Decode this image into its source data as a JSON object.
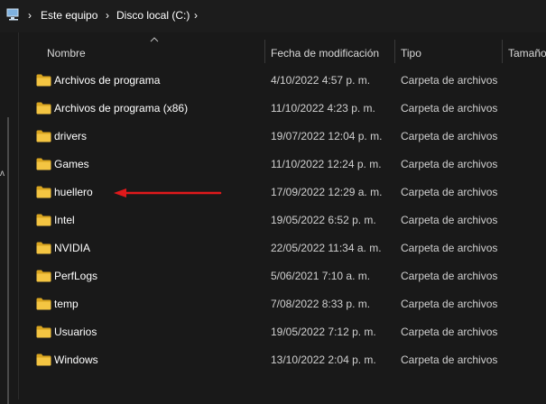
{
  "breadcrumb": {
    "items": [
      "Este equipo",
      "Disco local (C:)"
    ],
    "separator": "›"
  },
  "columns": {
    "name": "Nombre",
    "date": "Fecha de modificación",
    "type": "Tipo",
    "size": "Tamaño"
  },
  "rows": [
    {
      "name": "Archivos de programa",
      "date": "4/10/2022 4:57 p. m.",
      "type": "Carpeta de archivos"
    },
    {
      "name": "Archivos de programa (x86)",
      "date": "11/10/2022 4:23 p. m.",
      "type": "Carpeta de archivos"
    },
    {
      "name": "drivers",
      "date": "19/07/2022 12:04 p. m.",
      "type": "Carpeta de archivos"
    },
    {
      "name": "Games",
      "date": "11/10/2022 12:24 p. m.",
      "type": "Carpeta de archivos"
    },
    {
      "name": "huellero",
      "date": "17/09/2022 12:29 a. m.",
      "type": "Carpeta de archivos"
    },
    {
      "name": "Intel",
      "date": "19/05/2022 6:52 p. m.",
      "type": "Carpeta de archivos"
    },
    {
      "name": "NVIDIA",
      "date": "22/05/2022 11:34 a. m.",
      "type": "Carpeta de archivos"
    },
    {
      "name": "PerfLogs",
      "date": "5/06/2021 7:10 a. m.",
      "type": "Carpeta de archivos"
    },
    {
      "name": "temp",
      "date": "7/08/2022 8:33 p. m.",
      "type": "Carpeta de archivos"
    },
    {
      "name": "Usuarios",
      "date": "19/05/2022 7:12 p. m.",
      "type": "Carpeta de archivos"
    },
    {
      "name": "Windows",
      "date": "13/10/2022 2:04 p. m.",
      "type": "Carpeta de archivos"
    }
  ],
  "colors": {
    "background": "#191919",
    "folder": "#f4c542",
    "annotation_arrow": "#e0191b"
  },
  "icons": {
    "root": "this-pc-icon",
    "folder": "folder-icon",
    "sort": "sort-ascending-icon"
  },
  "annotation": {
    "type": "arrow",
    "points_to": "huellero"
  }
}
